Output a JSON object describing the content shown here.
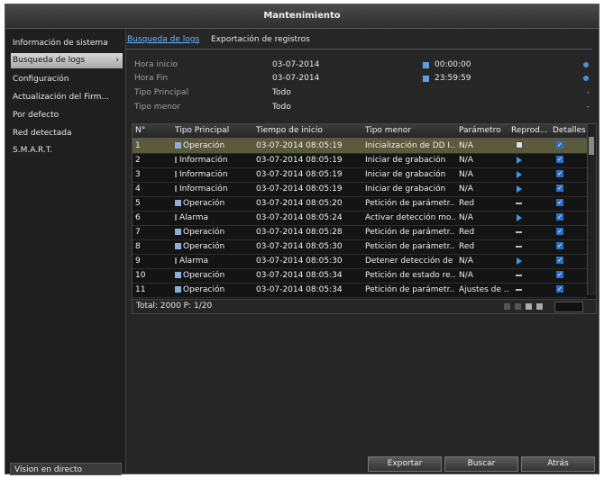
{
  "window": {
    "title": "Mantenimiento"
  },
  "sidebar": {
    "items": [
      {
        "label": "Información de sistema"
      },
      {
        "label": "Busqueda de logs",
        "chevron": "›"
      },
      {
        "label": "Configuración"
      },
      {
        "label": "Actualización del Firm..."
      },
      {
        "label": "Por defecto"
      },
      {
        "label": "Red detectada"
      },
      {
        "label": "S.M.A.R.T."
      }
    ],
    "live_label": "Vision en directo"
  },
  "tabs": [
    {
      "label": "Busqueda de logs"
    },
    {
      "label": "Exportación de registros"
    }
  ],
  "form": {
    "start_label": "Hora inicio",
    "start_date": "03-07-2014",
    "start_time": "00:00:00",
    "end_label": "Hora Fin",
    "end_date": "03-07-2014",
    "end_time": "23:59:59",
    "major_label": "Tipo Principal",
    "major_value": "Todo",
    "minor_label": "Tipo menor",
    "minor_value": "Todo",
    "dash": "-"
  },
  "table": {
    "headers": [
      "N°",
      "Tipo Principal",
      "Tiempo de inicio",
      "Tipo menor",
      "Parámetro",
      "Reprod...",
      "Detalles"
    ],
    "rows": [
      {
        "n": "1",
        "type": "Operación",
        "time": "03-07-2014 08:05:19",
        "minor": "Inicialización de DD I...",
        "param": "N/A",
        "play": "select",
        "major_icon": "doc"
      },
      {
        "n": "2",
        "type": "Información",
        "time": "03-07-2014 08:05:19",
        "minor": "Iniciar de grabación",
        "param": "N/A",
        "play": "play",
        "major_icon": "info"
      },
      {
        "n": "3",
        "type": "Información",
        "time": "03-07-2014 08:05:19",
        "minor": "Iniciar de grabación",
        "param": "N/A",
        "play": "play",
        "major_icon": "info"
      },
      {
        "n": "4",
        "type": "Información",
        "time": "03-07-2014 08:05:19",
        "minor": "Iniciar de grabación",
        "param": "N/A",
        "play": "play",
        "major_icon": "info"
      },
      {
        "n": "5",
        "type": "Operación",
        "time": "03-07-2014 08:05:20",
        "minor": "Petición de parámetr...",
        "param": "Red",
        "play": "minus",
        "major_icon": "doc"
      },
      {
        "n": "6",
        "type": "Alarma",
        "time": "03-07-2014 08:05:24",
        "minor": "Activar detección mo...",
        "param": "N/A",
        "play": "play",
        "major_icon": "info"
      },
      {
        "n": "7",
        "type": "Operación",
        "time": "03-07-2014 08:05:28",
        "minor": "Petición de parámetr...",
        "param": "Red",
        "play": "minus",
        "major_icon": "doc"
      },
      {
        "n": "8",
        "type": "Operación",
        "time": "03-07-2014 08:05:30",
        "minor": "Petición de parámetr...",
        "param": "Red",
        "play": "minus",
        "major_icon": "doc"
      },
      {
        "n": "9",
        "type": "Alarma",
        "time": "03-07-2014 08:05:30",
        "minor": "Detener detección de ...",
        "param": "N/A",
        "play": "play",
        "major_icon": "info"
      },
      {
        "n": "10",
        "type": "Operación",
        "time": "03-07-2014 08:05:34",
        "minor": "Petición de estado re...",
        "param": "N/A",
        "play": "minus",
        "major_icon": "doc"
      },
      {
        "n": "11",
        "type": "Operación",
        "time": "03-07-2014 08:05:34",
        "minor": "Petición de parámetr...",
        "param": "Ajustes de ...",
        "play": "minus",
        "major_icon": "doc"
      }
    ],
    "footer_total": "Total: 2000 P: 1/20"
  },
  "buttons": {
    "export": "Exportar",
    "search": "Buscar",
    "back": "Atrás"
  },
  "icons": {
    "chevron": "chevron-right-icon",
    "calendar": "calendar-icon",
    "clock": "clock-icon",
    "play": "play-icon",
    "detail": "check-icon"
  },
  "colors": {
    "accent": "#3a9bea",
    "selected_row": "#5a5a3c",
    "background": "#262626"
  }
}
